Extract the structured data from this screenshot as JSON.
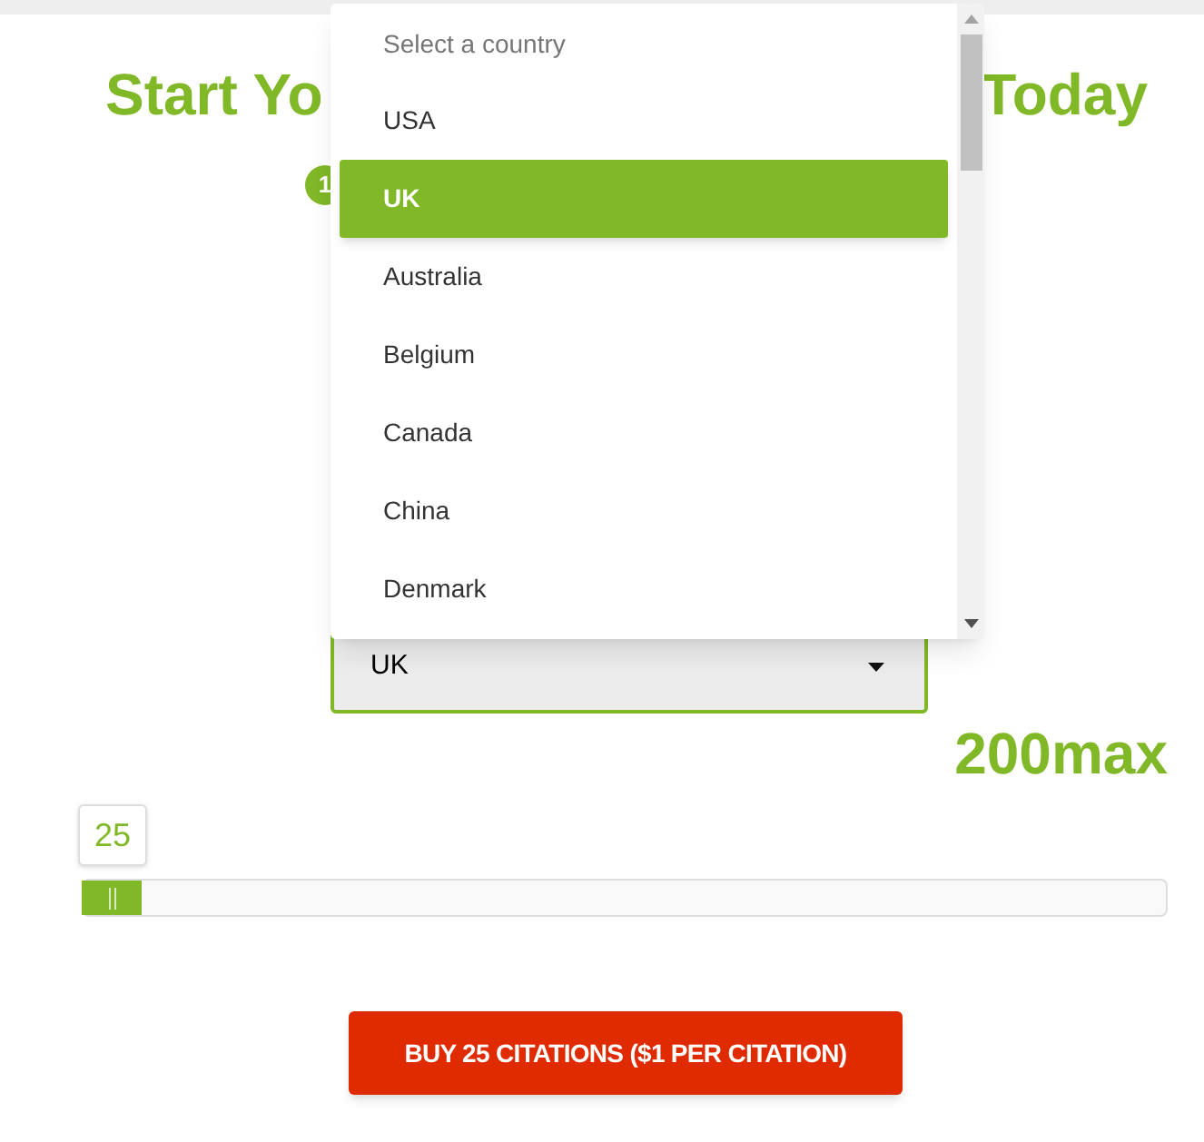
{
  "heading": {
    "left_part": "Start Yo",
    "right_part": "Today"
  },
  "step_badge": "1",
  "country_dropdown": {
    "prompt": "Select a country",
    "options": [
      {
        "label": "USA",
        "selected": false
      },
      {
        "label": "UK",
        "selected": true
      },
      {
        "label": "Australia",
        "selected": false
      },
      {
        "label": "Belgium",
        "selected": false
      },
      {
        "label": "Canada",
        "selected": false
      },
      {
        "label": "China",
        "selected": false
      },
      {
        "label": "Denmark",
        "selected": false
      }
    ]
  },
  "country_select": {
    "value": "UK"
  },
  "max_label": "200max",
  "citation_slider": {
    "value": "25"
  },
  "buy_button": "BUY 25 CITATIONS ($1 PER CITATION)"
}
